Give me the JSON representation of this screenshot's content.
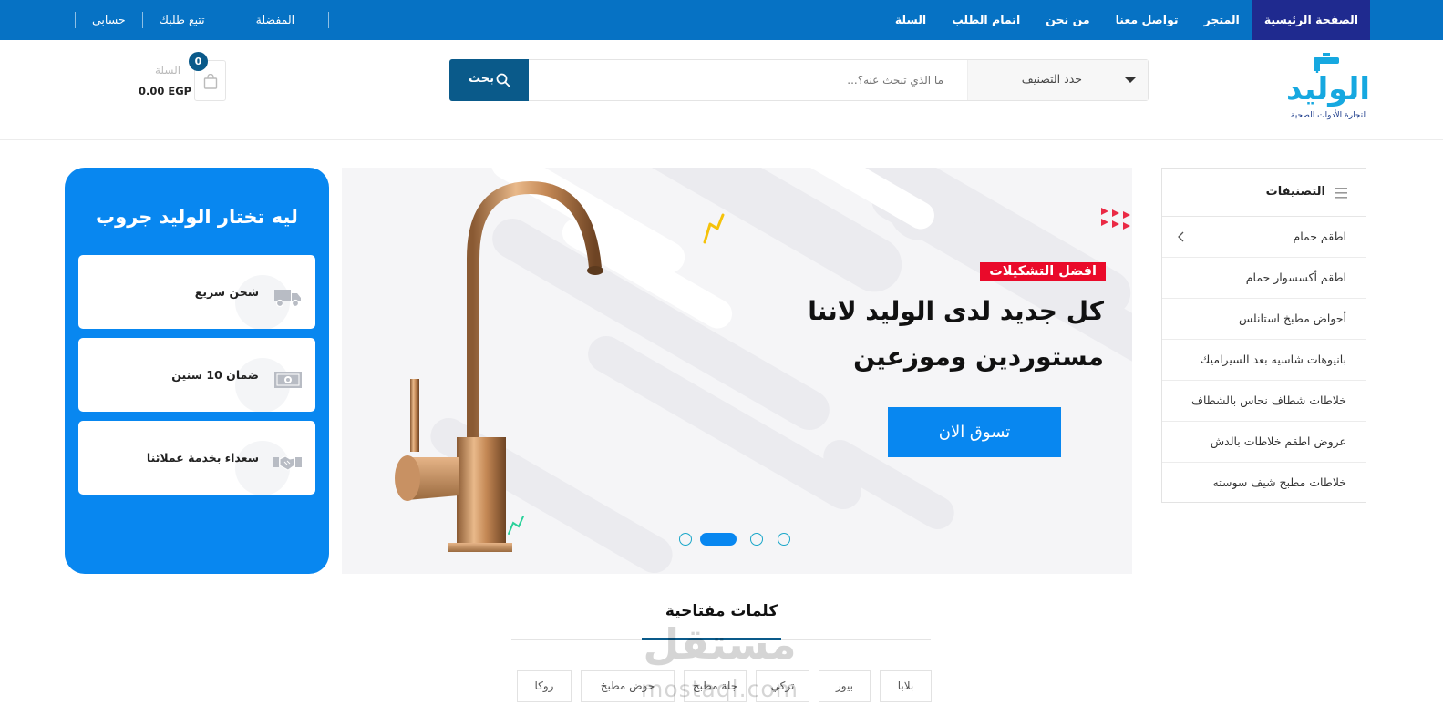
{
  "topnav": {
    "items": [
      {
        "label": "الصفحة الرئيسية"
      },
      {
        "label": "المتجر"
      },
      {
        "label": "تواصل معنا"
      },
      {
        "label": "من نحن"
      },
      {
        "label": "اتمام الطلب"
      },
      {
        "label": "السلة"
      }
    ],
    "utility": [
      {
        "label": "المفضلة"
      },
      {
        "label": "تتبع طلبك"
      },
      {
        "label": "حسابي"
      }
    ]
  },
  "header": {
    "logo": {
      "text": "الوليد",
      "tagline": "لتجارة الأدوات الصحية"
    },
    "search": {
      "category_label": "حدد التصنيف",
      "placeholder": "ما الذي تبحث عنه؟...",
      "button_label": "بحث"
    },
    "cart": {
      "label": "السلة",
      "count": "0",
      "total": "0.00 EGP"
    }
  },
  "categories": {
    "title": "التصنيفات",
    "items": [
      {
        "label": "اطقم حمام"
      },
      {
        "label": "اطقم أكسسوار حمام"
      },
      {
        "label": "أحواض مطبخ استانلس"
      },
      {
        "label": "بانيوهات شاسيه بعد السيراميك"
      },
      {
        "label": "خلاطات شطاف نحاس بالشطاف"
      },
      {
        "label": "عروض اطقم خلاطات بالدش"
      },
      {
        "label": "خلاطات مطبخ شيف سوسته"
      }
    ]
  },
  "hero": {
    "badge": "افضل التشكيلات",
    "headline_1": "كل جديد لدى الوليد لاننا",
    "headline_2": "مستوردين وموزعين",
    "cta": "تسوق الان",
    "slides_total": 4,
    "active_slide": 2
  },
  "why": {
    "title": "ليه تختار الوليد جروب",
    "features": [
      {
        "label": "شحن سريع",
        "icon": "truck-icon"
      },
      {
        "label": "ضمان 10 سنين",
        "icon": "money-icon"
      },
      {
        "label": "سعداء بخدمة عملائنا",
        "icon": "handshake-icon"
      }
    ]
  },
  "keywords": {
    "title": "كلمات مفتاحية",
    "tags": [
      {
        "label": "بلابا"
      },
      {
        "label": "بيور"
      },
      {
        "label": "تركي"
      },
      {
        "label": "جلة مطبخ"
      },
      {
        "label": "حوض مطبخ"
      },
      {
        "label": "روكا"
      }
    ]
  },
  "watermark": {
    "line1": "مستقل",
    "line2": "mostaql.com"
  },
  "colors": {
    "topbar": "#0672c4",
    "topbar_active": "#1f2a8f",
    "primary": "#0887f0",
    "dark_blue": "#0a5a8a",
    "badge_red": "#ea0a2a"
  }
}
